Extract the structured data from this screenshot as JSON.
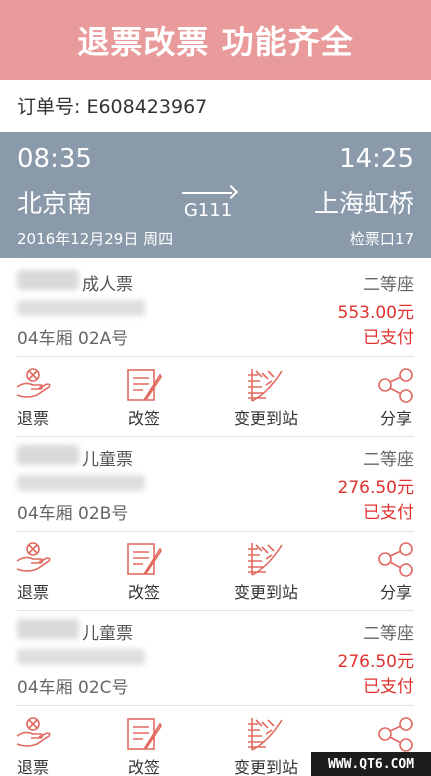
{
  "banner": {
    "title": "退票改票 功能齐全"
  },
  "order": {
    "text": "订单号: E608423967"
  },
  "trip": {
    "dep_time": "08:35",
    "arr_time": "14:25",
    "dep_station": "北京南",
    "arr_station": "上海虹桥",
    "train_no": "G111",
    "date": "2016年12月29日 周四",
    "gate": "检票口17"
  },
  "passengers": [
    {
      "ticket_type": "成人票",
      "seat": "04车厢 02A号",
      "class": "二等座",
      "price": "553.00元",
      "status": "已支付"
    },
    {
      "ticket_type": "儿童票",
      "seat": "04车厢 02B号",
      "class": "二等座",
      "price": "276.50元",
      "status": "已支付"
    },
    {
      "ticket_type": "儿童票",
      "seat": "04车厢 02C号",
      "class": "二等座",
      "price": "276.50元",
      "status": "已支付"
    }
  ],
  "actions": {
    "refund": "退票",
    "change": "改签",
    "change_station": "变更到站",
    "share": "分享"
  },
  "icons": {
    "refund": "refund-hand-icon",
    "change": "edit-document-icon",
    "change_station": "railway-track-icon",
    "share": "share-icon"
  },
  "colors": {
    "banner": "#e99a9a",
    "trip_panel": "#8a9aab",
    "accent_red": "#e0322e",
    "icon": "#e06a60"
  },
  "watermark": "WWW.QT6.COM"
}
